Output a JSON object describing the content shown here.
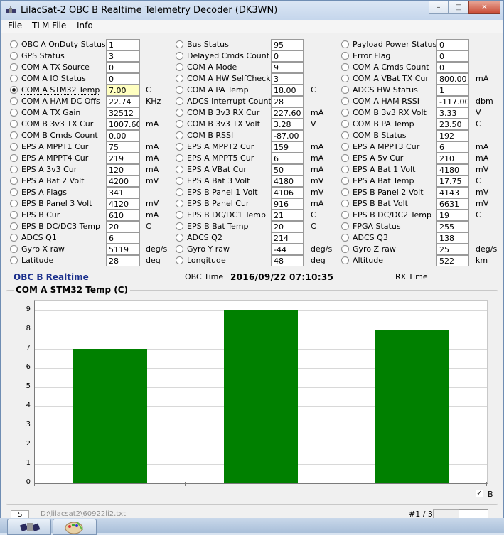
{
  "window": {
    "title": "LilacSat-2 OBC B Realtime Telemetry Decoder (DK3WN)",
    "minimize_label": "–",
    "maximize_label": "□",
    "close_label": "✕"
  },
  "menu": {
    "items": [
      "File",
      "TLM File",
      "Info"
    ]
  },
  "telemetry": {
    "col1": [
      {
        "label": "OBC A OnDuty Status",
        "value": "1",
        "unit": "",
        "selected": false
      },
      {
        "label": "GPS Status",
        "value": "3",
        "unit": "",
        "selected": false
      },
      {
        "label": "COM A TX Source",
        "value": "0",
        "unit": "",
        "selected": false
      },
      {
        "label": "COM A IO Status",
        "value": "0",
        "unit": "",
        "selected": false
      },
      {
        "label": "COM A STM32 Temp",
        "value": "7.00",
        "unit": "C",
        "selected": true
      },
      {
        "label": "COM A HAM DC Offs",
        "value": "22.74",
        "unit": "KHz",
        "selected": false
      },
      {
        "label": "COM A TX Gain",
        "value": "32512",
        "unit": "",
        "selected": false
      },
      {
        "label": "COM B 3v3 TX Cur",
        "value": "1007.60",
        "unit": "mA",
        "selected": false
      },
      {
        "label": "COM B Cmds Count",
        "value": "0.00",
        "unit": "",
        "selected": false
      },
      {
        "label": "EPS A MPPT1 Cur",
        "value": "75",
        "unit": "mA",
        "selected": false
      },
      {
        "label": "EPS A MPPT4 Cur",
        "value": "219",
        "unit": "mA",
        "selected": false
      },
      {
        "label": "EPS A 3v3 Cur",
        "value": "120",
        "unit": "mA",
        "selected": false
      },
      {
        "label": "EPS A Bat 2 Volt",
        "value": "4200",
        "unit": "mV",
        "selected": false
      },
      {
        "label": "EPS A Flags",
        "value": "341",
        "unit": "",
        "selected": false
      },
      {
        "label": "EPS B Panel 3 Volt",
        "value": "4120",
        "unit": "mV",
        "selected": false
      },
      {
        "label": "EPS B Cur",
        "value": "610",
        "unit": "mA",
        "selected": false
      },
      {
        "label": "EPS B DC/DC3 Temp",
        "value": "20",
        "unit": "C",
        "selected": false
      },
      {
        "label": "ADCS Q1",
        "value": "6",
        "unit": "",
        "selected": false
      },
      {
        "label": "Gyro X raw",
        "value": "5119",
        "unit": "deg/s",
        "selected": false
      },
      {
        "label": "Latitude",
        "value": "28",
        "unit": "deg",
        "selected": false
      }
    ],
    "col2": [
      {
        "label": "Bus Status",
        "value": "95",
        "unit": "",
        "selected": false
      },
      {
        "label": "Delayed Cmds Count",
        "value": "0",
        "unit": "",
        "selected": false
      },
      {
        "label": "COM A Mode",
        "value": "9",
        "unit": "",
        "selected": false
      },
      {
        "label": "COM A HW SelfCheck",
        "value": "3",
        "unit": "",
        "selected": false
      },
      {
        "label": "COM A PA Temp",
        "value": "18.00",
        "unit": "C",
        "selected": false
      },
      {
        "label": "ADCS Interrupt Count",
        "value": "28",
        "unit": "",
        "selected": false
      },
      {
        "label": "COM B 3v3 RX Cur",
        "value": "227.60",
        "unit": "mA",
        "selected": false
      },
      {
        "label": "COM B 3v3 TX Volt",
        "value": "3.28",
        "unit": "V",
        "selected": false
      },
      {
        "label": "COM B RSSI",
        "value": "-87.00",
        "unit": "",
        "selected": false
      },
      {
        "label": "EPS A MPPT2 Cur",
        "value": "159",
        "unit": "mA",
        "selected": false
      },
      {
        "label": "EPS A MPPT5 Cur",
        "value": "6",
        "unit": "mA",
        "selected": false
      },
      {
        "label": "EPS A VBat Cur",
        "value": "50",
        "unit": "mA",
        "selected": false
      },
      {
        "label": "EPS A Bat 3 Volt",
        "value": "4180",
        "unit": "mV",
        "selected": false
      },
      {
        "label": "EPS B Panel 1 Volt",
        "value": "4106",
        "unit": "mV",
        "selected": false
      },
      {
        "label": "EPS B Panel Cur",
        "value": "916",
        "unit": "mA",
        "selected": false
      },
      {
        "label": "EPS B DC/DC1 Temp",
        "value": "21",
        "unit": "C",
        "selected": false
      },
      {
        "label": "EPS B Bat Temp",
        "value": "20",
        "unit": "C",
        "selected": false
      },
      {
        "label": "ADCS Q2",
        "value": "214",
        "unit": "",
        "selected": false
      },
      {
        "label": "Gyro Y raw",
        "value": "-44",
        "unit": "deg/s",
        "selected": false
      },
      {
        "label": "Longitude",
        "value": "48",
        "unit": "deg",
        "selected": false
      }
    ],
    "col3": [
      {
        "label": "Payload Power Status",
        "value": "0",
        "unit": "",
        "selected": false
      },
      {
        "label": "Error Flag",
        "value": "0",
        "unit": "",
        "selected": false
      },
      {
        "label": "COM A Cmds Count",
        "value": "0",
        "unit": "",
        "selected": false
      },
      {
        "label": "COM A VBat TX Cur",
        "value": "800.00",
        "unit": "mA",
        "selected": false
      },
      {
        "label": "ADCS HW Status",
        "value": "1",
        "unit": "",
        "selected": false
      },
      {
        "label": "COM A HAM RSSI",
        "value": "-117.00",
        "unit": "dbm",
        "selected": false
      },
      {
        "label": "COM B 3v3 RX Volt",
        "value": "3.33",
        "unit": "V",
        "selected": false
      },
      {
        "label": "COM B PA Temp",
        "value": "23.50",
        "unit": "C",
        "selected": false
      },
      {
        "label": "COM B Status",
        "value": "192",
        "unit": "",
        "selected": false
      },
      {
        "label": "EPS A MPPT3 Cur",
        "value": "6",
        "unit": "mA",
        "selected": false
      },
      {
        "label": "EPS A 5v Cur",
        "value": "210",
        "unit": "mA",
        "selected": false
      },
      {
        "label": "EPS A Bat 1 Volt",
        "value": "4180",
        "unit": "mV",
        "selected": false
      },
      {
        "label": "EPS A Bat Temp",
        "value": "17.75",
        "unit": "C",
        "selected": false
      },
      {
        "label": "EPS B Panel 2 Volt",
        "value": "4143",
        "unit": "mV",
        "selected": false
      },
      {
        "label": "EPS B Bat Volt",
        "value": "6631",
        "unit": "mV",
        "selected": false
      },
      {
        "label": "EPS B DC/DC2 Temp",
        "value": "19",
        "unit": "C",
        "selected": false
      },
      {
        "label": "FPGA Status",
        "value": "255",
        "unit": "",
        "selected": false
      },
      {
        "label": "ADCS Q3",
        "value": "138",
        "unit": "",
        "selected": false
      },
      {
        "label": "Gyro Z raw",
        "value": "25",
        "unit": "deg/s",
        "selected": false
      },
      {
        "label": "Altitude",
        "value": "522",
        "unit": "km",
        "selected": false
      }
    ]
  },
  "status": {
    "realtime_title": "OBC B Realtime",
    "obc_time_label": "OBC Time",
    "obc_time_value": "2016/09/22 07:10:35",
    "rx_time_label": "RX Time"
  },
  "chart_group_title": "COM A STM32 Temp (C)",
  "chart_data": {
    "type": "bar",
    "title": "COM A STM32 Temp (C)",
    "series": [
      {
        "name": "B",
        "values": [
          7,
          9,
          8
        ],
        "color": "#008000"
      }
    ],
    "yticks": [
      "0",
      "1",
      "2",
      "3",
      "4",
      "5",
      "6",
      "7",
      "8",
      "9"
    ],
    "ylim": [
      0,
      9.5
    ],
    "grid": true,
    "legend": {
      "label": "B",
      "checked": true,
      "placement": "bottom-right"
    }
  },
  "statusbar": {
    "s_label": "S",
    "path": "D:\\lilacsat2\\60922li2.txt",
    "page": "#1 / 3"
  },
  "taskbar": {
    "items": [
      "app-icon",
      "paint-icon"
    ]
  }
}
